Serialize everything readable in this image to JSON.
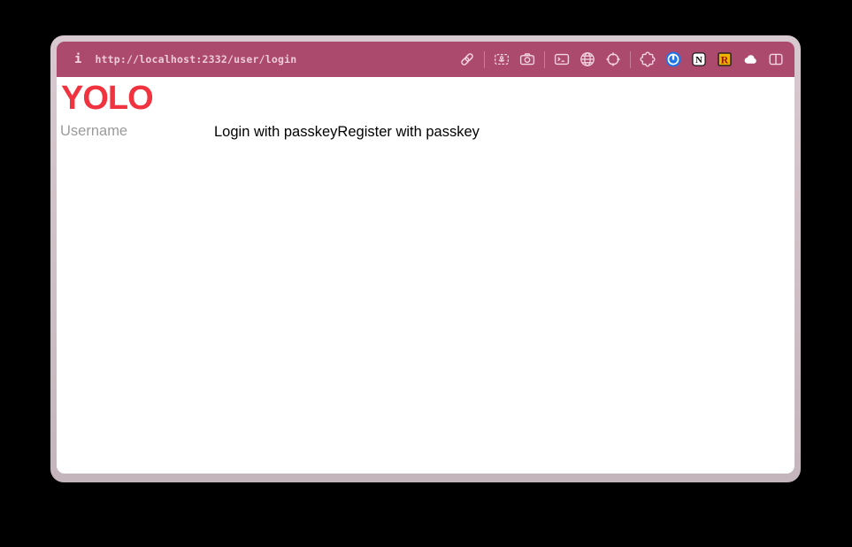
{
  "browser": {
    "toolbar": {
      "info_glyph": "i",
      "url": "http://localhost:2332/user/login",
      "icons": {
        "link": "link-icon",
        "snapshot": "snapshot-icon",
        "camera": "camera-icon",
        "terminal": "terminal-icon",
        "globe": "globe-icon",
        "crosshair": "crosshair-icon",
        "extensions": "extensions-puzzle-icon",
        "onepassword_glyph": "1",
        "notion_glyph": "N",
        "r_badge_glyph": "R",
        "cloud": "cloud-icon",
        "split_view": "split-view-icon"
      }
    }
  },
  "page": {
    "logo_text": "YOLO",
    "username_placeholder": "Username",
    "login_button_label": "Login with passkey",
    "register_button_label": "Register with passkey"
  },
  "colors": {
    "background": "#000000",
    "window_frame": "#cfc0c7",
    "toolbar_bg": "#ac4a6e",
    "toolbar_icon": "#f3d6e1",
    "url_text": "#eecbd8",
    "logo_red": "#f0333e",
    "placeholder_gray": "#9b9b9b",
    "onepassword_blue": "#1d74e8",
    "notion_bg": "#ffffff",
    "r_badge_gold": "#f0b400",
    "r_badge_letter": "#9c1313"
  }
}
